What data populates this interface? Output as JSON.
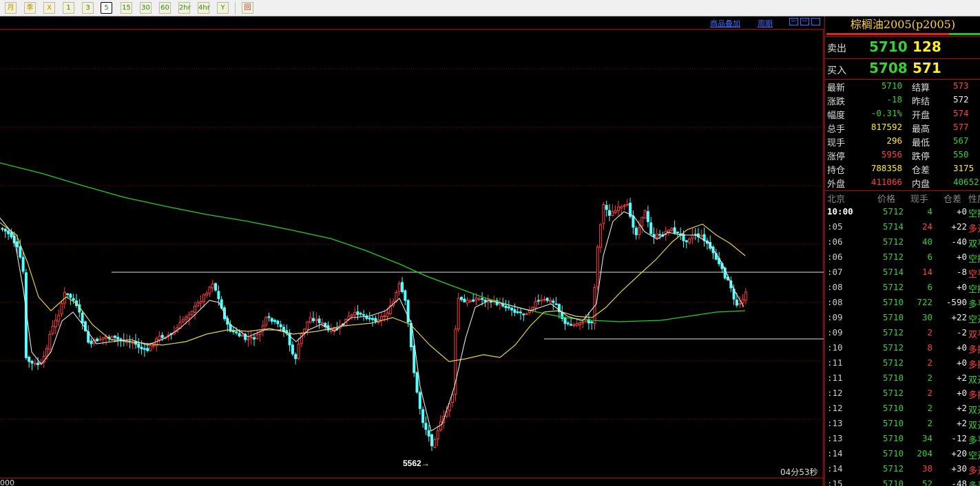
{
  "toolbar": {
    "buttons": [
      {
        "label": "月",
        "name": "period-month-button",
        "color": "orange"
      },
      {
        "label": "季",
        "name": "period-quarter-button",
        "color": "orange"
      },
      {
        "label": "X",
        "name": "period-x-button",
        "color": "orange"
      },
      {
        "label": "1",
        "name": "period-1-button",
        "color": "green"
      },
      {
        "label": "3",
        "name": "period-3-button",
        "color": "green"
      },
      {
        "label": "5",
        "name": "period-5-button",
        "color": "green",
        "selected": true
      },
      {
        "label": "15",
        "name": "period-15-button",
        "color": "green"
      },
      {
        "label": "30",
        "name": "period-30-button",
        "color": "green"
      },
      {
        "label": "60",
        "name": "period-60-button",
        "color": "green"
      },
      {
        "label": "2hr",
        "name": "period-2hr-button",
        "color": "green"
      },
      {
        "label": "4hr",
        "name": "period-4hr-button",
        "color": "green"
      },
      {
        "label": "Y",
        "name": "period-y-button",
        "color": "green"
      },
      {
        "label": "回",
        "name": "draw-tool-button",
        "color": "red"
      }
    ]
  },
  "chart_header": {
    "overlay_link": "商品叠加",
    "period_link": "周期"
  },
  "chart": {
    "low_label": "5562",
    "countdown": "04分53秒",
    "axis_fragment": "000",
    "colors": {
      "up": "#ff3c3c",
      "down": "#54ffff",
      "ma_short": "#e8e8e8",
      "ma_mid": "#e6d24a",
      "ma_long": "#1fd21f",
      "grid": "#8b0000"
    }
  },
  "panel": {
    "title": "棕榈油2005(p2005)",
    "sell_label": "卖出",
    "sell_price": "5710",
    "sell_volume": "128",
    "buy_label": "买入",
    "buy_price": "5708",
    "buy_volume": "571",
    "stats": [
      {
        "l1": "最新",
        "v1": "5710",
        "c1": "g",
        "l2": "结算",
        "v2": "573",
        "c2": "r"
      },
      {
        "l1": "涨跌",
        "v1": "-18",
        "c1": "g",
        "l2": "昨结",
        "v2": "572",
        "c2": "w"
      },
      {
        "l1": "幅度",
        "v1": "-0.31%",
        "c1": "g",
        "l2": "开盘",
        "v2": "574",
        "c2": "r"
      },
      {
        "l1": "总手",
        "v1": "817592",
        "c1": "y",
        "l2": "最高",
        "v2": "577",
        "c2": "r"
      },
      {
        "l1": "现手",
        "v1": "296",
        "c1": "y",
        "l2": "最低",
        "v2": "567",
        "c2": "g"
      },
      {
        "l1": "涨停",
        "v1": "5956",
        "c1": "r",
        "l2": "跌停",
        "v2": "550",
        "c2": "g"
      },
      {
        "l1": "持仓",
        "v1": "788358",
        "c1": "y",
        "l2": "仓差",
        "v2": "3175",
        "c2": "y"
      },
      {
        "l1": "外盘",
        "v1": "411066",
        "c1": "r",
        "l2": "内盘",
        "v2": "40652",
        "c2": "g"
      }
    ],
    "trades_header": {
      "time": "北京",
      "price": "价格",
      "vol": "现手",
      "oi": "仓差",
      "nature": "性质"
    },
    "trades": [
      {
        "time": "10:00",
        "price": "5712",
        "vol": "4",
        "oi": "+0",
        "nature": "空换",
        "pc": "g",
        "vc": "g",
        "nc": "g",
        "bold": true
      },
      {
        "time": ":05",
        "price": "5714",
        "vol": "24",
        "oi": "+22",
        "nature": "多开",
        "pc": "g",
        "vc": "r",
        "nc": "r"
      },
      {
        "time": ":06",
        "price": "5712",
        "vol": "40",
        "oi": "-40",
        "nature": "双平",
        "pc": "g",
        "vc": "g",
        "nc": "g"
      },
      {
        "time": ":06",
        "price": "5712",
        "vol": "6",
        "oi": "+0",
        "nature": "空换",
        "pc": "g",
        "vc": "g",
        "nc": "g"
      },
      {
        "time": ":07",
        "price": "5714",
        "vol": "14",
        "oi": "-8",
        "nature": "空平",
        "pc": "g",
        "vc": "r",
        "nc": "r"
      },
      {
        "time": ":08",
        "price": "5712",
        "vol": "6",
        "oi": "+0",
        "nature": "空换",
        "pc": "g",
        "vc": "g",
        "nc": "g"
      },
      {
        "time": ":08",
        "price": "5710",
        "vol": "722",
        "oi": "-590",
        "nature": "多平",
        "pc": "g",
        "vc": "g",
        "nc": "g"
      },
      {
        "time": ":09",
        "price": "5710",
        "vol": "30",
        "oi": "+22",
        "nature": "空开",
        "pc": "g",
        "vc": "g",
        "nc": "g"
      },
      {
        "time": ":09",
        "price": "5712",
        "vol": "2",
        "oi": "-2",
        "nature": "双平",
        "pc": "g",
        "vc": "r",
        "nc": "r"
      },
      {
        "time": ":10",
        "price": "5712",
        "vol": "8",
        "oi": "+0",
        "nature": "多换",
        "pc": "g",
        "vc": "r",
        "nc": "r"
      },
      {
        "time": ":11",
        "price": "5712",
        "vol": "2",
        "oi": "+0",
        "nature": "多换",
        "pc": "g",
        "vc": "r",
        "nc": "r"
      },
      {
        "time": ":11",
        "price": "5710",
        "vol": "2",
        "oi": "+2",
        "nature": "双开",
        "pc": "g",
        "vc": "g",
        "nc": "g"
      },
      {
        "time": ":12",
        "price": "5712",
        "vol": "2",
        "oi": "+0",
        "nature": "多换",
        "pc": "g",
        "vc": "r",
        "nc": "r"
      },
      {
        "time": ":12",
        "price": "5710",
        "vol": "2",
        "oi": "+2",
        "nature": "双开",
        "pc": "g",
        "vc": "g",
        "nc": "g"
      },
      {
        "time": ":13",
        "price": "5710",
        "vol": "2",
        "oi": "+2",
        "nature": "双开",
        "pc": "g",
        "vc": "g",
        "nc": "g"
      },
      {
        "time": ":13",
        "price": "5710",
        "vol": "34",
        "oi": "-12",
        "nature": "多平",
        "pc": "g",
        "vc": "g",
        "nc": "g"
      },
      {
        "time": ":14",
        "price": "5710",
        "vol": "204",
        "oi": "+20",
        "nature": "空开",
        "pc": "g",
        "vc": "g",
        "nc": "g"
      },
      {
        "time": ":14",
        "price": "5712",
        "vol": "38",
        "oi": "+30",
        "nature": "多开",
        "pc": "g",
        "vc": "r",
        "nc": "r"
      },
      {
        "time": ":15",
        "price": "5710",
        "vol": "52",
        "oi": "-48",
        "nature": "多平",
        "pc": "g",
        "vc": "g",
        "nc": "g"
      }
    ]
  }
}
